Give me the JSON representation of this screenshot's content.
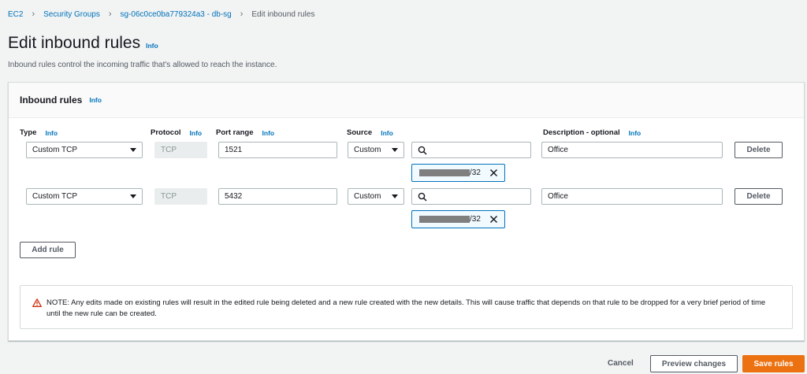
{
  "breadcrumb": {
    "items": [
      "EC2",
      "Security Groups",
      "sg-06c0ce0ba779324a3 - db-sg"
    ],
    "current": "Edit inbound rules"
  },
  "page": {
    "title": "Edit inbound rules",
    "info": "Info",
    "description": "Inbound rules control the incoming traffic that's allowed to reach the instance."
  },
  "panel": {
    "title": "Inbound rules",
    "info": "Info",
    "columns": {
      "type": "Type",
      "protocol": "Protocol",
      "port_range": "Port range",
      "source": "Source",
      "description": "Description - optional",
      "info": "Info"
    },
    "rules": [
      {
        "type": "Custom TCP",
        "protocol": "TCP",
        "port_range": "1521",
        "source": "Custom",
        "search_value": "",
        "cidr_suffix": "/32",
        "description": "Office",
        "delete_label": "Delete"
      },
      {
        "type": "Custom TCP",
        "protocol": "TCP",
        "port_range": "5432",
        "source": "Custom",
        "search_value": "",
        "cidr_suffix": "/32",
        "description": "Office",
        "delete_label": "Delete"
      }
    ],
    "add_rule_label": "Add rule",
    "note": "NOTE: Any edits made on existing rules will result in the edited rule being deleted and a new rule created with the new details. This will cause traffic that depends on that rule to be dropped for a very brief period of time until the new rule can be created."
  },
  "footer": {
    "cancel_label": "Cancel",
    "preview_label": "Preview changes",
    "save_label": "Save rules"
  },
  "colors": {
    "link": "#0073bb",
    "primary": "#ec7211",
    "warning": "#d13212",
    "token_border": "#0073bb"
  }
}
